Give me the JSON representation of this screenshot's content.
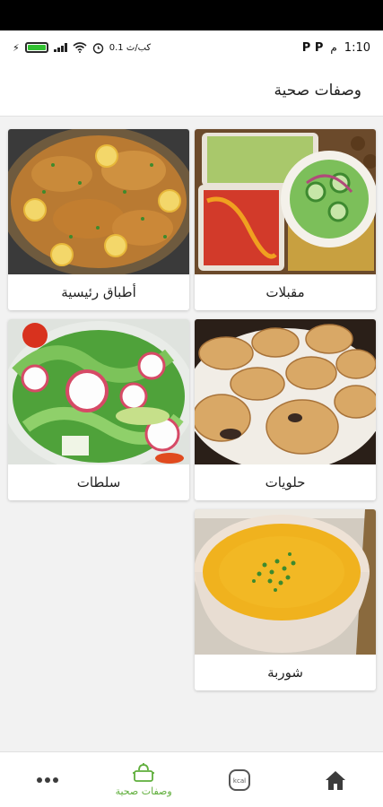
{
  "status_bar": {
    "time": "1:10",
    "ampm": "م",
    "indicators": "P  P",
    "speed": "0.1 كب/ث",
    "battery_level": 1.0,
    "battery_color": "#32c132"
  },
  "app_bar": {
    "title": "وصفات صحية"
  },
  "categories": [
    {
      "label": "مقبلات",
      "image": "appetizers-photo"
    },
    {
      "label": "أطباق رئيسية",
      "image": "main-dishes-photo"
    },
    {
      "label": "حلويات",
      "image": "desserts-photo"
    },
    {
      "label": "سلطات",
      "image": "salads-photo"
    },
    {
      "label": "شوربة",
      "image": "soup-photo"
    }
  ],
  "bottom_nav": {
    "items": [
      {
        "icon": "home-icon",
        "label": ""
      },
      {
        "icon": "kcal-icon",
        "label": ""
      },
      {
        "icon": "chef-pot-icon",
        "label": "وصفات صحية",
        "active": true
      },
      {
        "icon": "more-dots-icon",
        "label": ""
      }
    ],
    "active_color": "#5fae3b"
  }
}
